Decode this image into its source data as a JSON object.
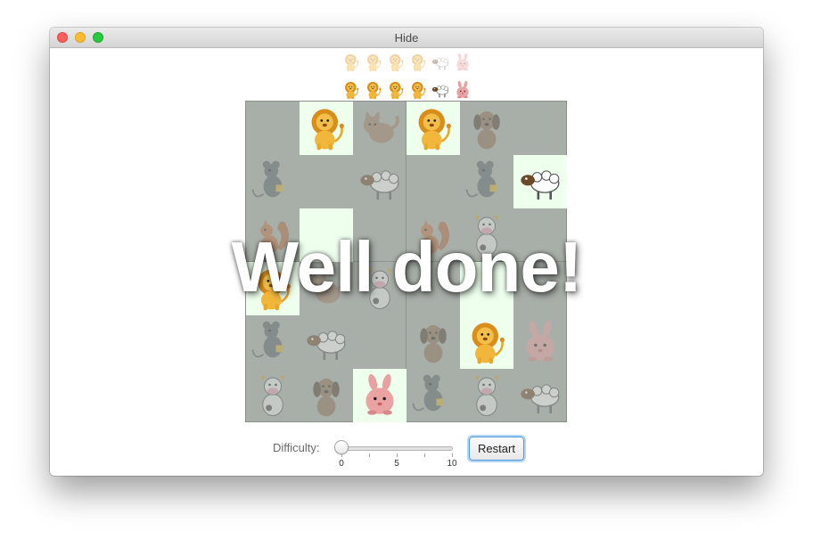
{
  "window": {
    "title": "Hide"
  },
  "targets": {
    "faded": [
      "lion-icon",
      "lion-icon",
      "lion-icon",
      "lion-icon",
      "sheep-icon",
      "rabbit-icon"
    ],
    "found": [
      "lion-icon",
      "lion-icon",
      "lion-icon",
      "lion-icon",
      "sheep-icon",
      "rabbit-icon"
    ]
  },
  "grid": {
    "rows": [
      [
        {
          "animal": "empty"
        },
        {
          "animal": "lion-icon",
          "revealed": true
        },
        {
          "animal": "cat-icon"
        },
        {
          "animal": "lion-icon",
          "revealed": true
        },
        {
          "animal": "dog-icon"
        },
        {
          "animal": "empty"
        }
      ],
      [
        {
          "animal": "mouse-icon"
        },
        {
          "animal": "empty"
        },
        {
          "animal": "sheep-icon"
        },
        {
          "animal": "empty"
        },
        {
          "animal": "mouse-icon"
        },
        {
          "animal": "sheep-icon",
          "revealed": true
        }
      ],
      [
        {
          "animal": "squirrel-icon"
        },
        {
          "animal": "empty",
          "revealed": true
        },
        {
          "animal": "empty"
        },
        {
          "animal": "squirrel-icon"
        },
        {
          "animal": "cow-icon"
        },
        {
          "animal": "empty"
        }
      ],
      [
        {
          "animal": "lion-icon",
          "revealed": true
        },
        {
          "animal": "cat-icon"
        },
        {
          "animal": "cow-icon"
        },
        {
          "animal": "empty"
        },
        {
          "animal": "empty",
          "revealed": true
        },
        {
          "animal": "empty"
        }
      ],
      [
        {
          "animal": "mouse-icon"
        },
        {
          "animal": "sheep-icon"
        },
        {
          "animal": "empty"
        },
        {
          "animal": "dog-icon"
        },
        {
          "animal": "lion-icon",
          "revealed": true
        },
        {
          "animal": "rabbit-icon"
        }
      ],
      [
        {
          "animal": "cow-icon"
        },
        {
          "animal": "dog-icon"
        },
        {
          "animal": "rabbit-icon",
          "revealed": true
        },
        {
          "animal": "mouse-icon"
        },
        {
          "animal": "cow-icon"
        },
        {
          "animal": "sheep-icon"
        }
      ]
    ]
  },
  "message": "Well done!",
  "controls": {
    "difficulty_label": "Difficulty:",
    "difficulty_value": 0,
    "difficulty_min": 0,
    "difficulty_max": 10,
    "tick_labels": [
      "0",
      "5",
      "10"
    ],
    "restart_label": "Restart"
  }
}
